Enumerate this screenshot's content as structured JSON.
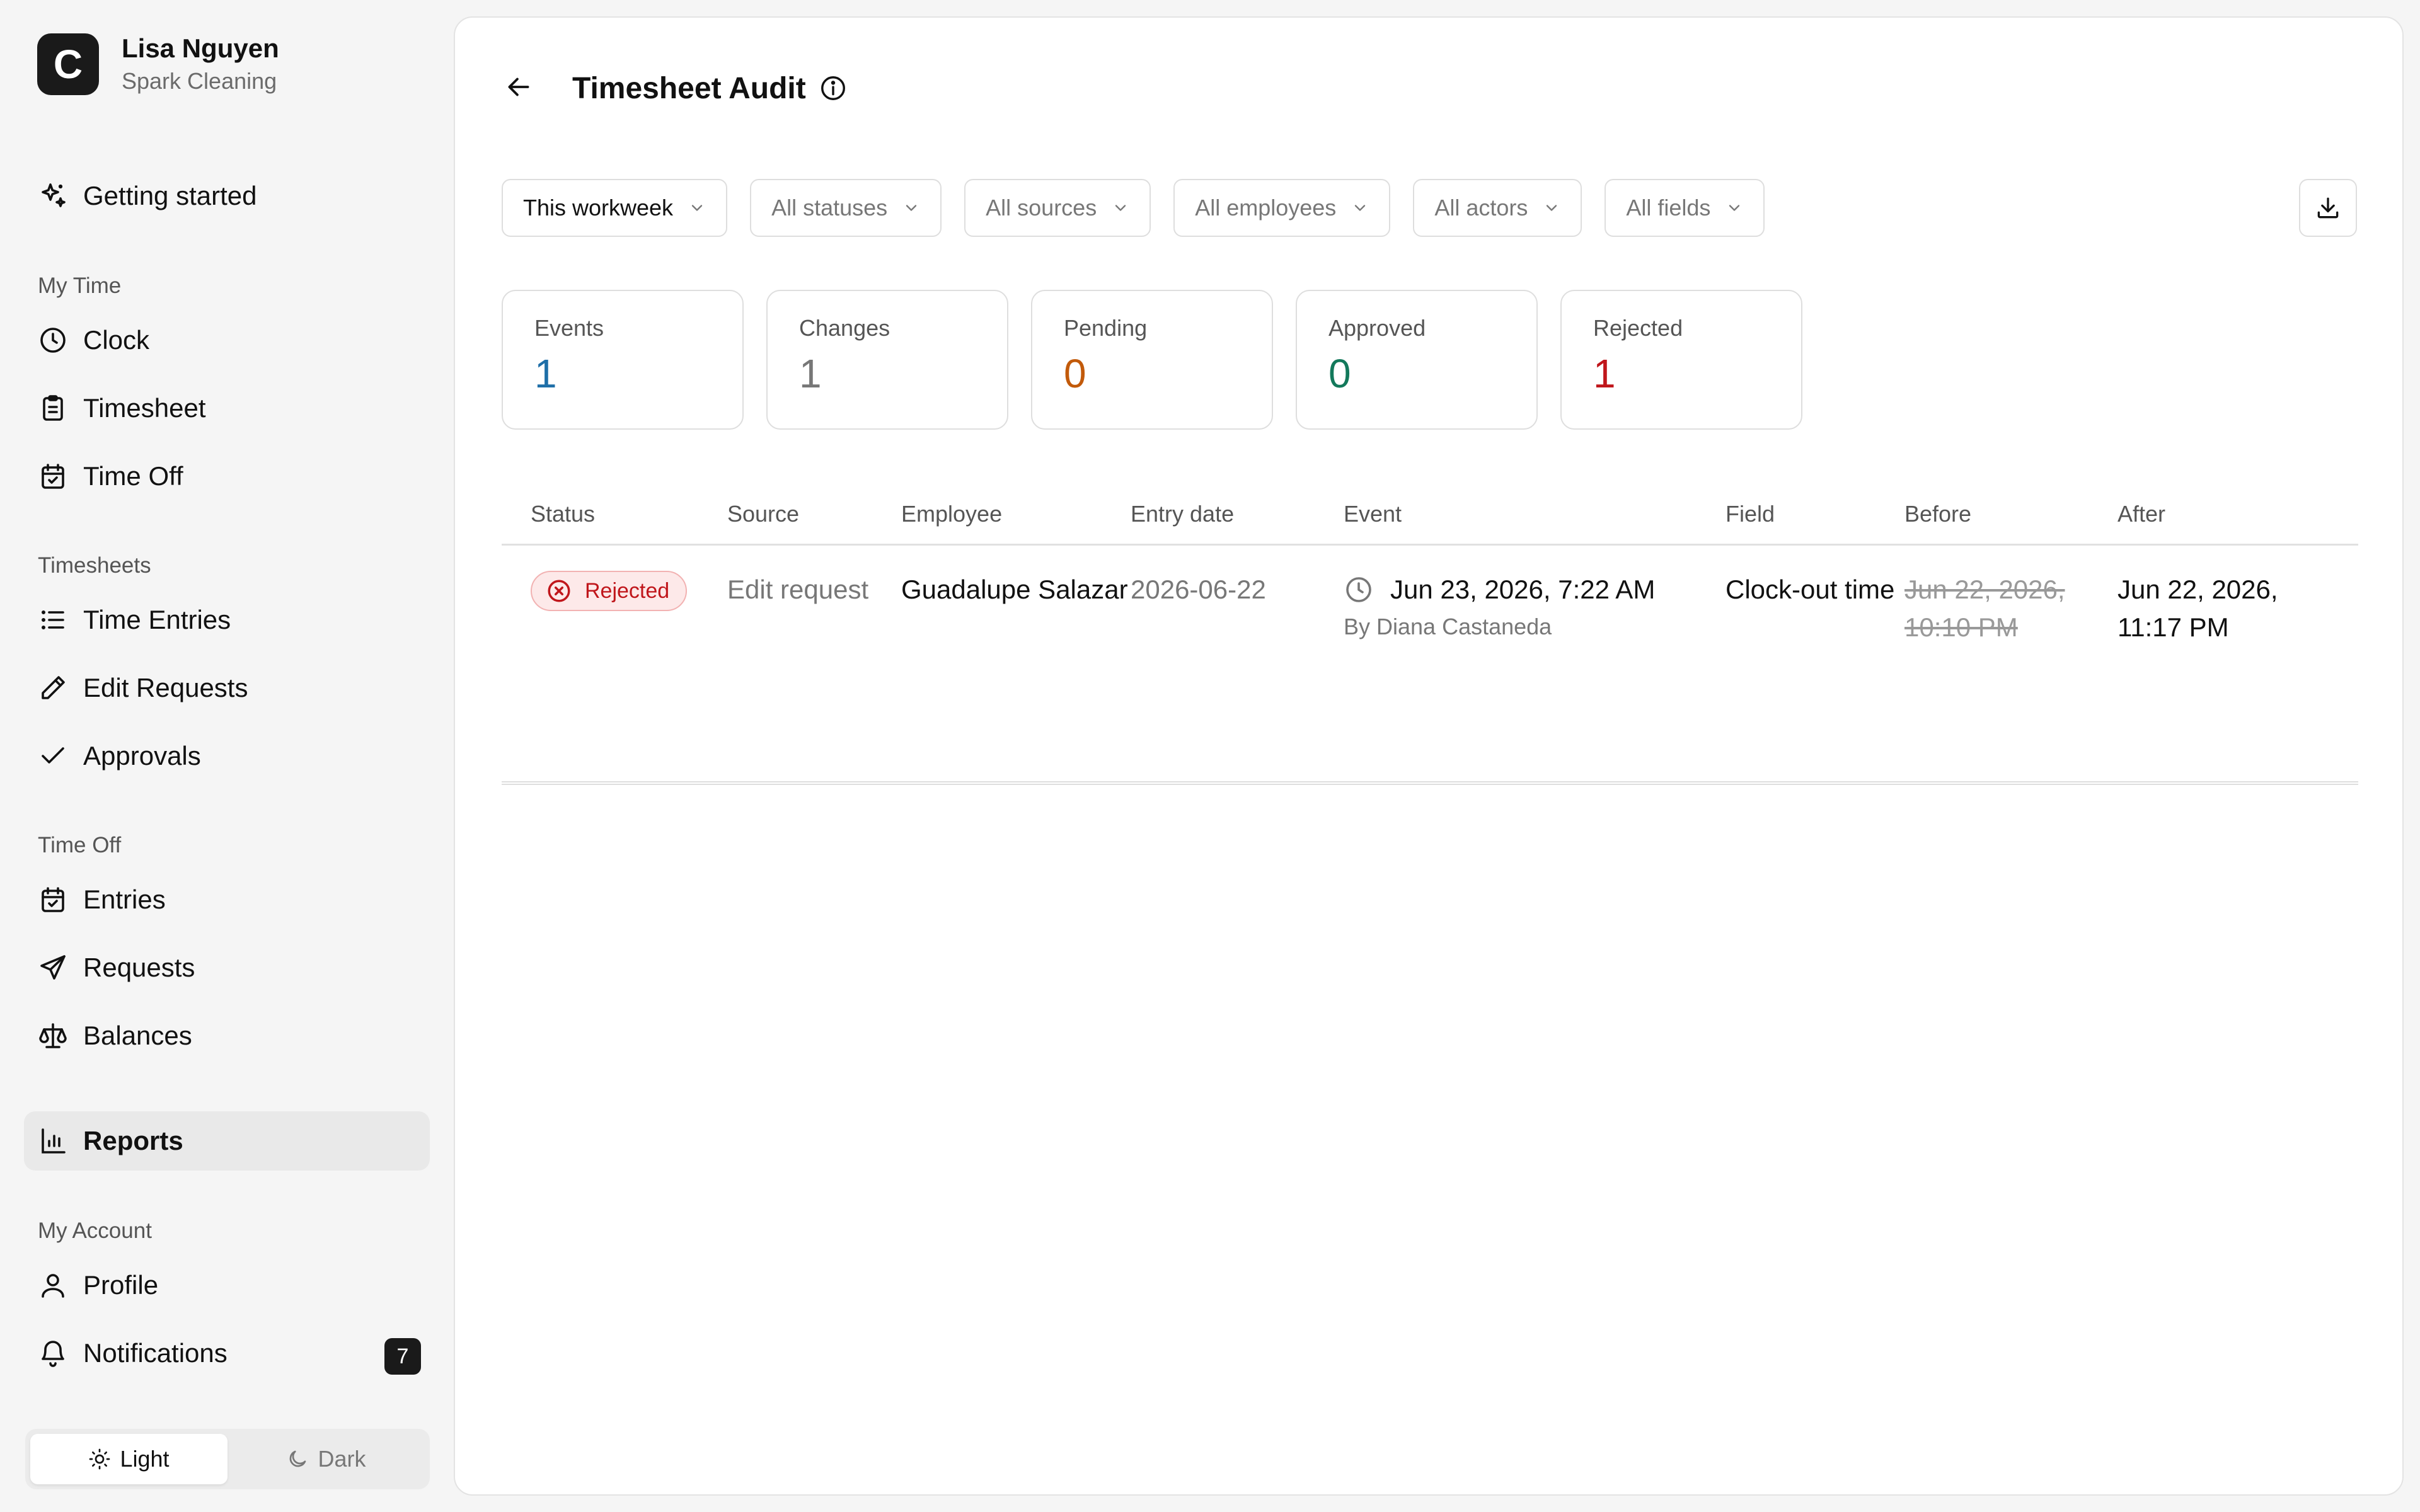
{
  "user": {
    "name": "Lisa Nguyen",
    "org": "Spark Cleaning",
    "logo_letter": "C"
  },
  "sidebar": {
    "getting_started": "Getting started",
    "sections": {
      "my_time": "My Time",
      "timesheets": "Timesheets",
      "time_off": "Time Off",
      "my_account": "My Account"
    },
    "items": {
      "clock": "Clock",
      "timesheet": "Timesheet",
      "time_off": "Time Off",
      "time_entries": "Time Entries",
      "edit_requests": "Edit Requests",
      "approvals": "Approvals",
      "entries": "Entries",
      "requests": "Requests",
      "balances": "Balances",
      "reports": "Reports",
      "profile": "Profile",
      "notifications": "Notifications"
    },
    "notifications_count": "7",
    "theme": {
      "light": "Light",
      "dark": "Dark",
      "selected": "Light"
    }
  },
  "page": {
    "title": "Timesheet Audit"
  },
  "filters": {
    "period": "This workweek",
    "statuses": "All statuses",
    "sources": "All sources",
    "employees": "All employees",
    "actors": "All actors",
    "fields": "All fields"
  },
  "stats": [
    {
      "label": "Events",
      "value": "1",
      "color": "#1f6fa8"
    },
    {
      "label": "Changes",
      "value": "1",
      "color": "#777777"
    },
    {
      "label": "Pending",
      "value": "0",
      "color": "#c25a0a"
    },
    {
      "label": "Approved",
      "value": "0",
      "color": "#13795b"
    },
    {
      "label": "Rejected",
      "value": "1",
      "color": "#c0161b"
    }
  ],
  "table": {
    "headers": {
      "status": "Status",
      "source": "Source",
      "employee": "Employee",
      "entry_date": "Entry date",
      "event": "Event",
      "field": "Field",
      "before": "Before",
      "after": "After"
    },
    "rows": [
      {
        "status": "Rejected",
        "source": "Edit request",
        "employee": "Guadalupe Salazar",
        "entry_date": "2026-06-22",
        "event_time": "Jun 23, 2026, 7:22 AM",
        "event_by": "By Diana Castaneda",
        "field": "Clock-out time",
        "before": "Jun 22, 2026, 10:10 PM",
        "after": "Jun 22, 2026, 11:17 PM"
      }
    ]
  }
}
